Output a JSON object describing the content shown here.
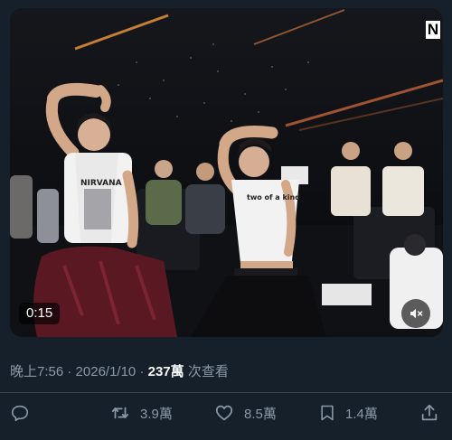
{
  "video": {
    "brand_badge": "N",
    "elapsed": "0:15",
    "shirt_text_left": "NIRVANA",
    "shirt_text_right": "two of a kind"
  },
  "meta": {
    "time": "晚上7:56",
    "separator": " · ",
    "date": "2026/1/10",
    "views": "237萬",
    "views_suffix": " 次查看"
  },
  "actions": {
    "reply_count": "",
    "retweet_count": "3.9萬",
    "like_count": "8.5萬",
    "bookmark_count": "1.4萬"
  },
  "colors": {
    "background": "#15202b",
    "secondary_text": "#8b98a5",
    "primary_text": "#f7f9f9",
    "divider": "#38444d"
  },
  "icons": [
    "mute-icon",
    "reply-icon",
    "retweet-icon",
    "like-icon",
    "bookmark-icon",
    "share-icon"
  ]
}
